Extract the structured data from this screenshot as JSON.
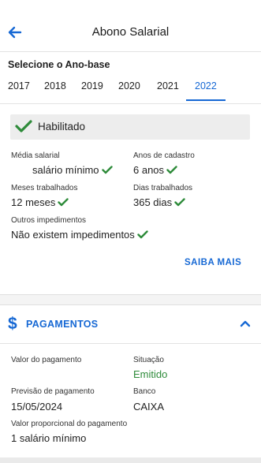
{
  "header": {
    "title": "Abono Salarial",
    "back_icon": "arrow-left-icon"
  },
  "year_selector": {
    "label": "Selecione o Ano-base",
    "years": [
      "2017",
      "2018",
      "2019",
      "2020",
      "2021",
      "2022"
    ],
    "selected": "2022"
  },
  "status": {
    "text": "Habilitado",
    "icon": "check-icon"
  },
  "info": {
    "media_salarial": {
      "label": "Média salarial",
      "value": "salário mínimo"
    },
    "anos_cadastro": {
      "label": "Anos de cadastro",
      "value": "6 anos"
    },
    "meses_trabalhados": {
      "label": "Meses trabalhados",
      "value": "12 meses"
    },
    "dias_trabalhados": {
      "label": "Dias trabalhados",
      "value": "365 dias"
    },
    "outros_impedimentos": {
      "label": "Outros impedimentos",
      "value": "Não existem impedimentos"
    }
  },
  "saiba_mais": "SAIBA MAIS",
  "pagamentos": {
    "title": "PAGAMENTOS",
    "valor": {
      "label": "Valor do pagamento",
      "value": ""
    },
    "situacao": {
      "label": "Situação",
      "value": "Emitido"
    },
    "previsao": {
      "label": "Previsão de pagamento",
      "value": "15/05/2024"
    },
    "banco": {
      "label": "Banco",
      "value": "CAIXA"
    },
    "proporcional": {
      "label": "Valor proporcional do pagamento",
      "value": "1 salário mínimo"
    }
  },
  "colors": {
    "accent": "#1668d4",
    "success": "#2e8b3a",
    "status_bg": "#ededed"
  }
}
